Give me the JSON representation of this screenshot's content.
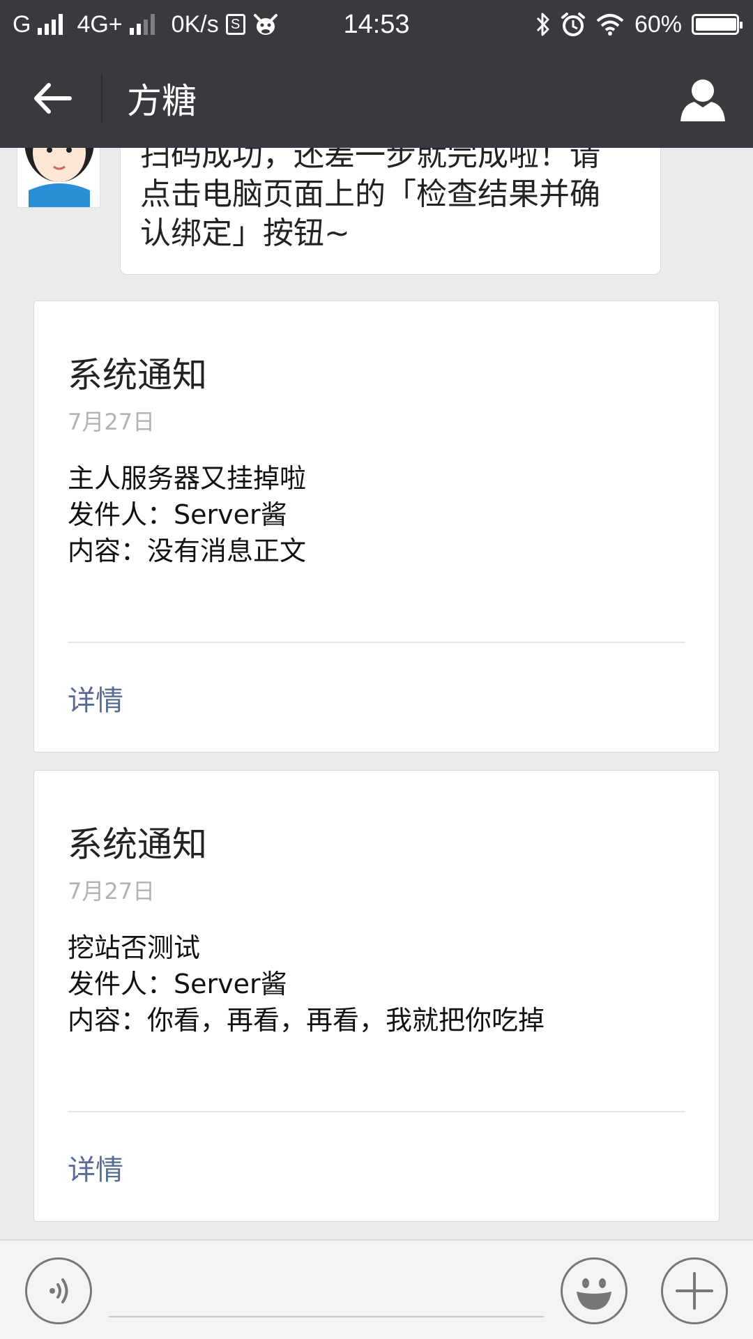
{
  "status_bar": {
    "carrier1": "G",
    "carrier2": "4G+",
    "speed": "0K/s",
    "sim_label": "S",
    "time": "14:53",
    "battery": "60%",
    "battery_level": 0.6
  },
  "navbar": {
    "title": "方糖",
    "back_icon": "arrow-left-icon",
    "profile_icon": "person-icon"
  },
  "chat_bubble": {
    "lines": [
      "扫码成功，还差一步就完成啦！请",
      "点击电脑页面上的「检查结果并确",
      "认绑定」按钮~"
    ]
  },
  "cards": [
    {
      "title": "系统通知",
      "date": "7月27日",
      "line1": "主人服务器又挂掉啦",
      "line2": "发件人：Server酱",
      "line3": "内容：没有消息正文",
      "detail": "详情"
    },
    {
      "title": "系统通知",
      "date": "7月27日",
      "line1": "挖站否测试",
      "line2": "发件人：Server酱",
      "line3": "内容：你看，再看，再看，我就把你吃掉",
      "detail": "详情"
    }
  ],
  "input_bar": {
    "voice_icon": "voice-icon",
    "emoji_icon": "emoji-icon",
    "plus_icon": "plus-icon",
    "text_value": ""
  },
  "colors": {
    "bar_bg": "#393a3f",
    "page_bg": "#ebebeb",
    "link": "#576b95"
  }
}
